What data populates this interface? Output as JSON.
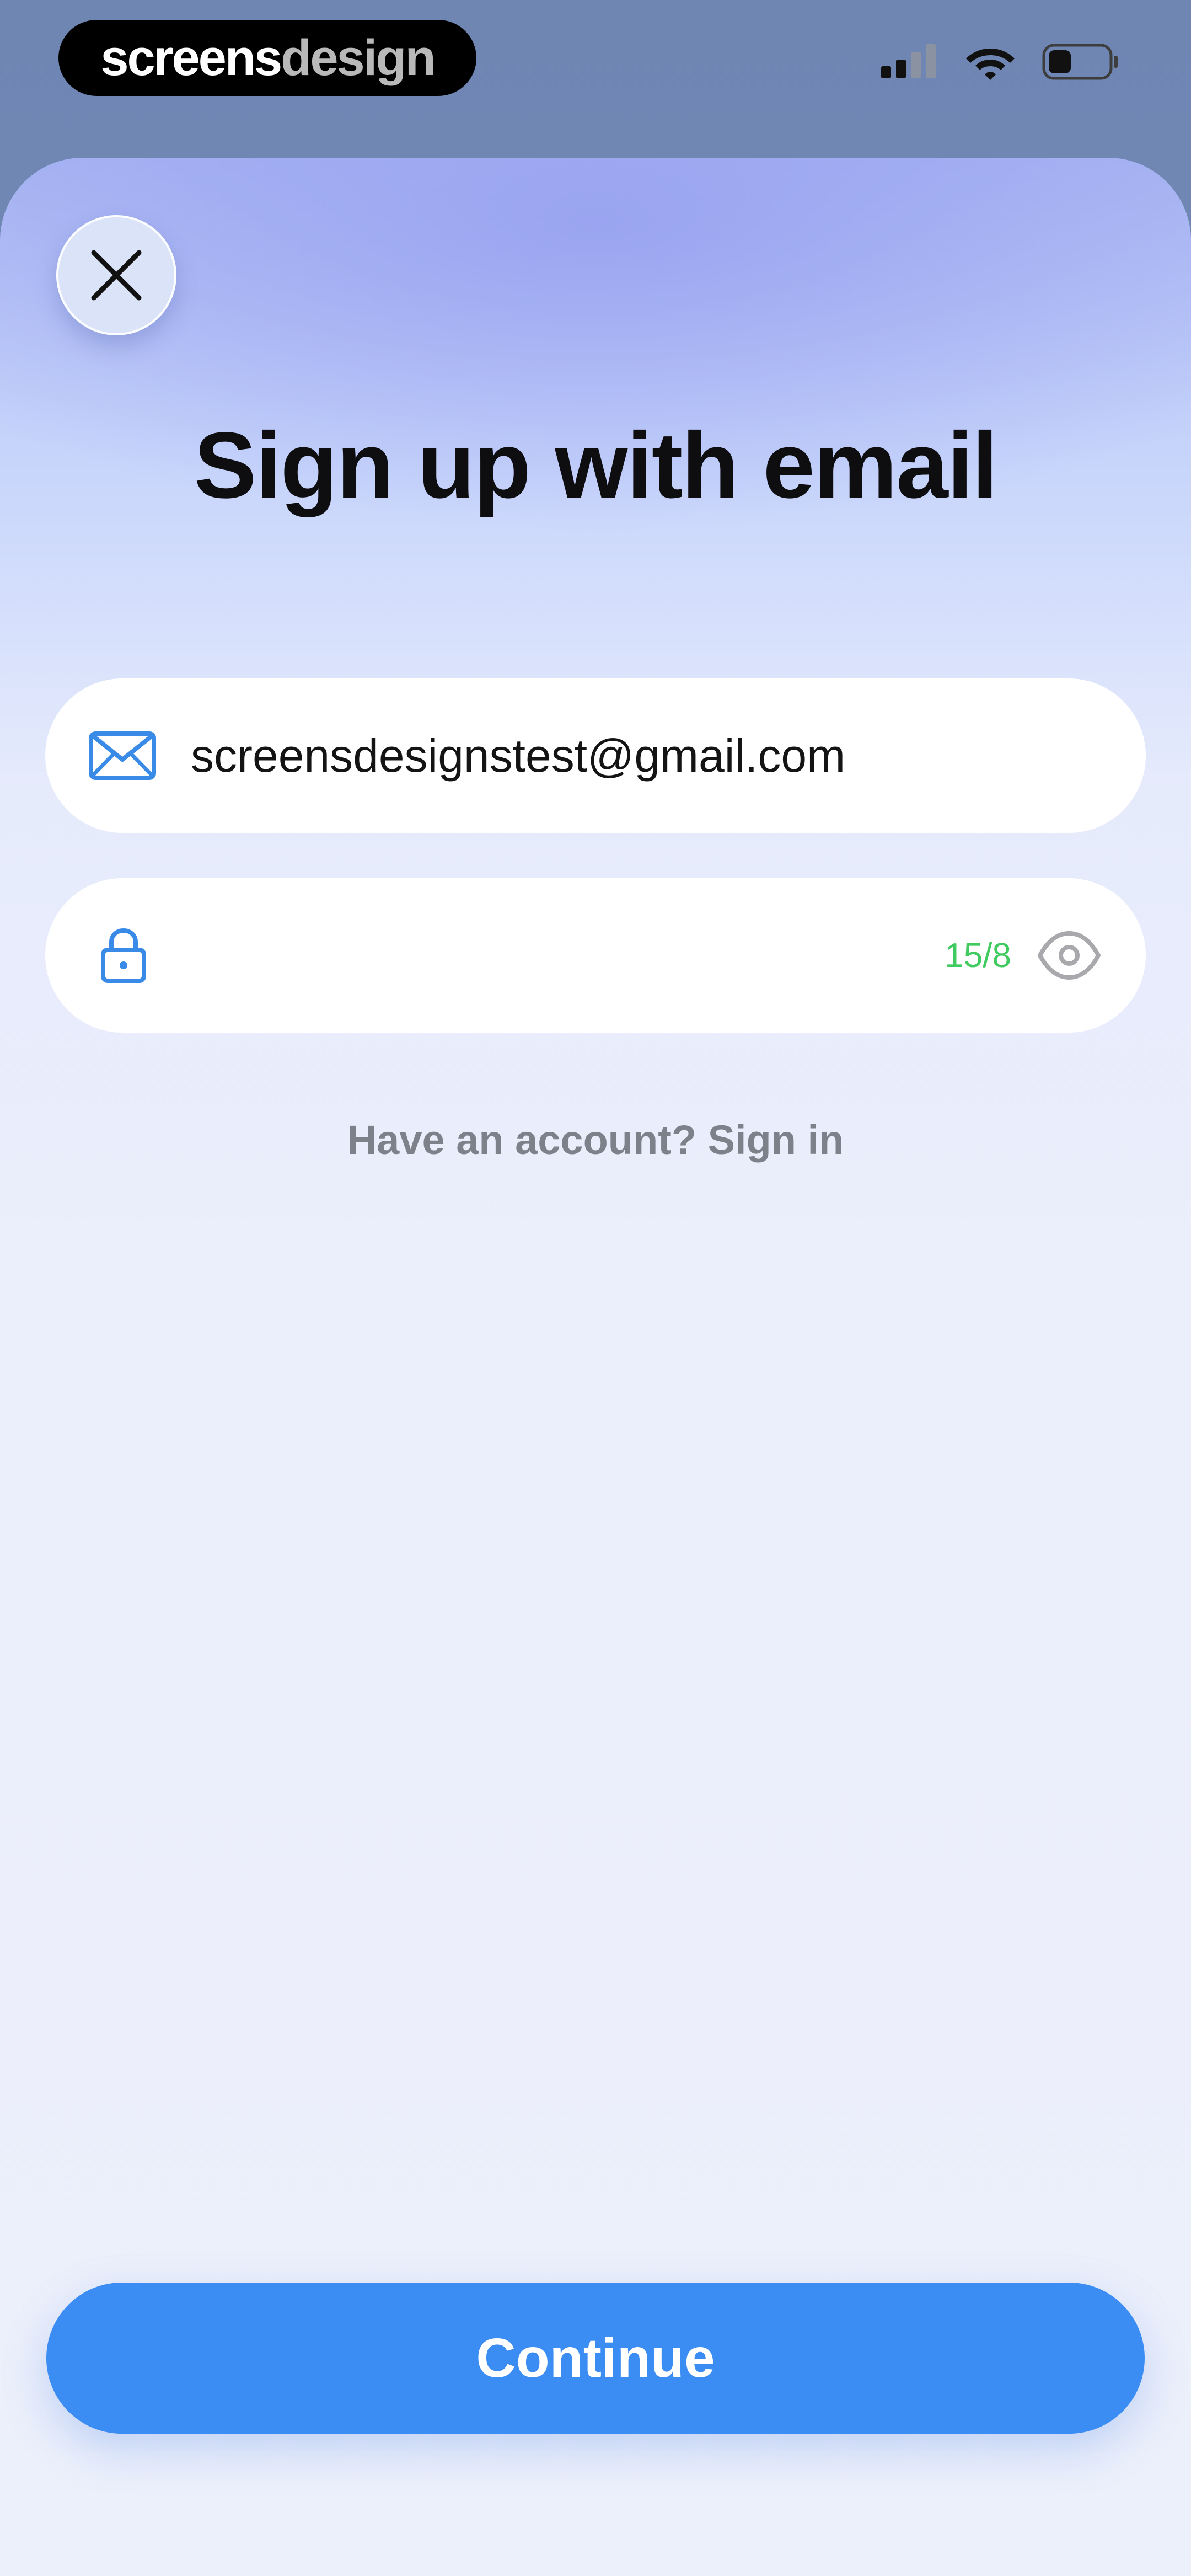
{
  "brand": {
    "part1": "screens",
    "part2": "design"
  },
  "status_bar": {
    "icons": [
      "signal-icon",
      "wifi-icon",
      "battery-icon"
    ]
  },
  "sheet": {
    "title": "Sign up with email",
    "email": {
      "value": "screensdesignstest@gmail.com",
      "icon": "mail-icon"
    },
    "password": {
      "counter": "15/8",
      "icon": "lock-icon",
      "toggle_icon": "eye-icon"
    },
    "signin_text": "Have an account? Sign in",
    "continue_label": "Continue"
  },
  "colors": {
    "accent": "#3b8df3",
    "counter": "#3fcb5f",
    "icon_blue": "#3a8ae8",
    "muted_text": "#7e818a"
  }
}
